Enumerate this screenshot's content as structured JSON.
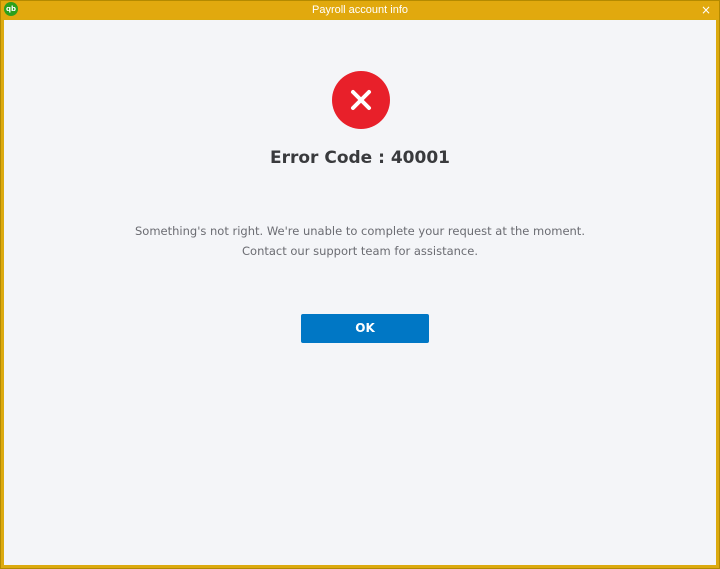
{
  "window": {
    "title": "Payroll account info",
    "app_icon_text": "qb",
    "close_glyph": "×"
  },
  "dialog": {
    "icon": "error-x-icon",
    "error_title": "Error Code : 40001",
    "message": "Something's not right. We're unable to complete your request at the moment. Contact our support team for assistance.",
    "ok_label": "OK"
  },
  "colors": {
    "titlebar": "#e1a90e",
    "error_red": "#e8202a",
    "button_blue": "#0077c5",
    "background": "#f4f5f8"
  }
}
